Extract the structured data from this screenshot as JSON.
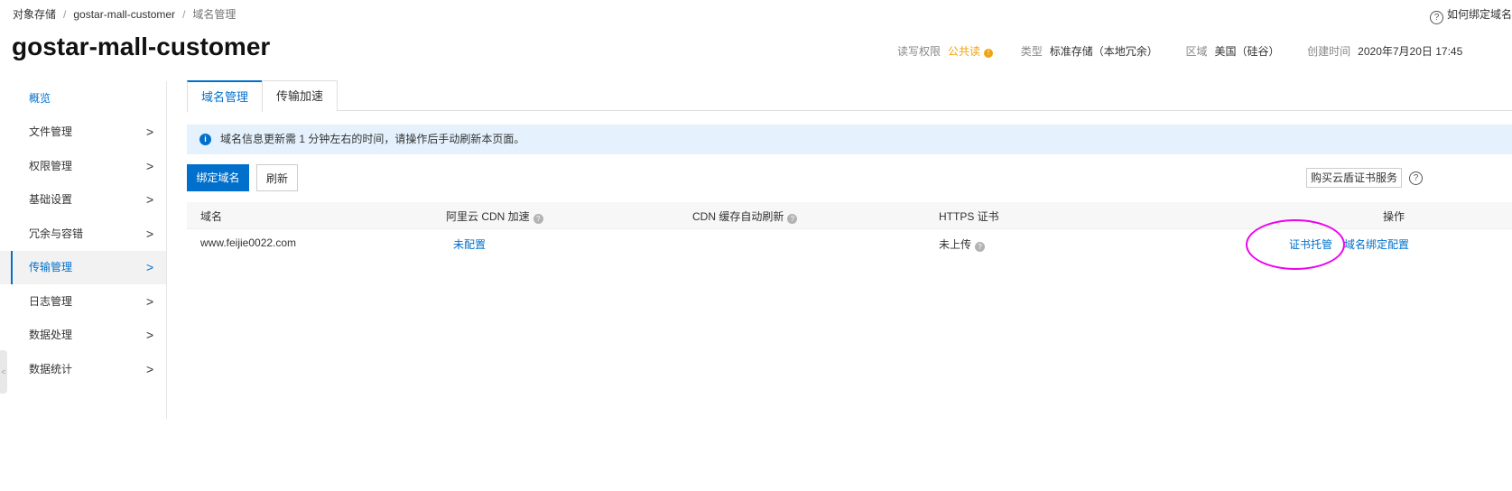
{
  "breadcrumb": {
    "items": [
      "对象存储",
      "gostar-mall-customer"
    ],
    "current": "域名管理"
  },
  "help": {
    "label": "如何绑定域名"
  },
  "page_title": "gostar-mall-customer",
  "meta": {
    "rw_key": "读写权限",
    "rw_value": "公共读",
    "type_key": "类型",
    "type_value": "标准存储（本地冗余）",
    "region_key": "区域",
    "region_value": "美国（硅谷）",
    "created_key": "创建时间",
    "created_value": "2020年7月20日 17:45"
  },
  "sidebar": {
    "items": [
      {
        "label": "概览"
      },
      {
        "label": "文件管理"
      },
      {
        "label": "权限管理"
      },
      {
        "label": "基础设置"
      },
      {
        "label": "冗余与容错"
      },
      {
        "label": "传输管理"
      },
      {
        "label": "日志管理"
      },
      {
        "label": "数据处理"
      },
      {
        "label": "数据统计"
      }
    ]
  },
  "tabs": [
    {
      "label": "域名管理"
    },
    {
      "label": "传输加速"
    }
  ],
  "notice": {
    "text": "域名信息更新需 1 分钟左右的时间，请操作后手动刷新本页面。"
  },
  "toolbar": {
    "bind_label": "绑定域名",
    "refresh_label": "刷新",
    "buy_label": "购买云盾证书服务"
  },
  "table": {
    "headers": {
      "domain": "域名",
      "cdn": "阿里云 CDN 加速",
      "cache": "CDN 缓存自动刷新",
      "https": "HTTPS 证书",
      "ops": "操作"
    },
    "rows": [
      {
        "domain": "www.feijie0022.com",
        "cdn": "未配置",
        "https": "未上传",
        "op1": "证书托管",
        "op2": "域名绑定配置"
      }
    ]
  },
  "colors": {
    "accent": "#0070cc",
    "warning": "#f0a30a",
    "annotation": "#ee00ee"
  }
}
